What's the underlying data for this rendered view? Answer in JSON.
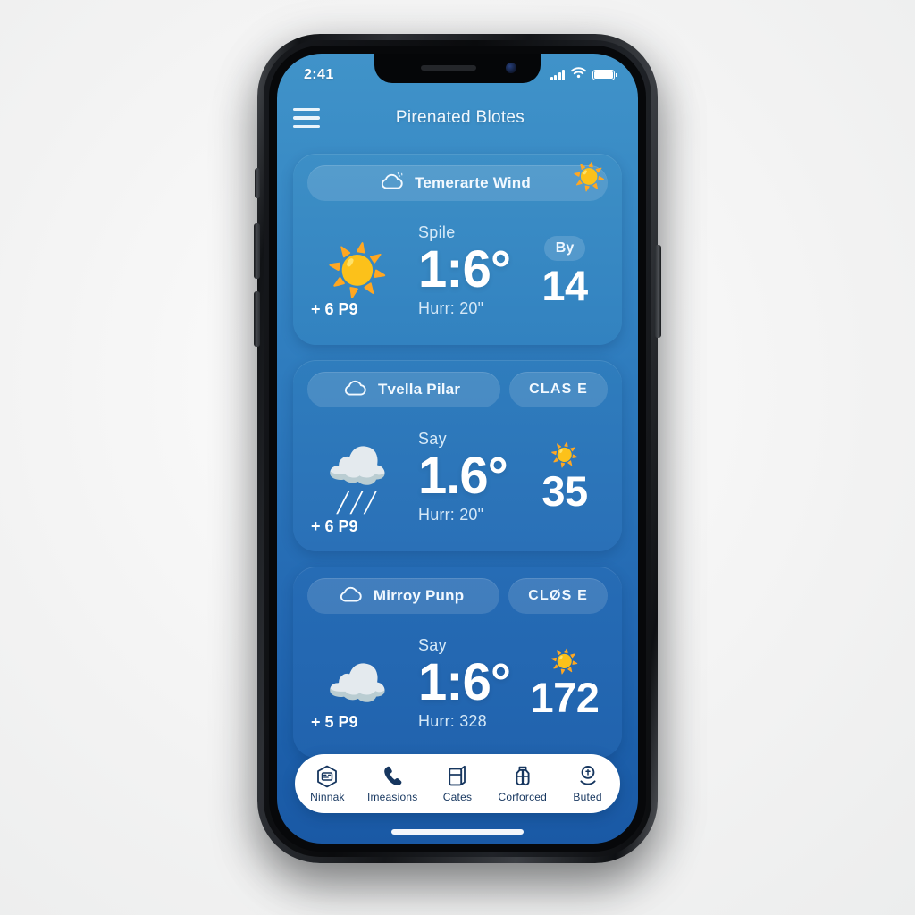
{
  "status_bar": {
    "time": "2:41",
    "signal_icon": "cellular-signal-icon",
    "wifi_icon": "wifi-icon",
    "battery_icon": "battery-full-icon"
  },
  "app_bar": {
    "menu_icon": "hamburger-menu-icon",
    "title": "Pirenated Blotes"
  },
  "cards": [
    {
      "head_icon": "cloud-outline-icon",
      "head_label": "Temerarte Wind",
      "tag": null,
      "corner_icon": "sun-icon",
      "glyph": "☀️",
      "glyph_name": "sun-icon",
      "drops": null,
      "plus_line": "+ 6 P9",
      "temp_label": "Spile",
      "temp_value": "1:6°",
      "temp_sub": "Hurr: 20\"",
      "badge": "By",
      "right_icon": null,
      "right_number": "14"
    },
    {
      "head_icon": "cloud-outline-icon",
      "head_label": "Tvella Pilar",
      "tag": "CLAS E",
      "corner_icon": null,
      "glyph": "☁️",
      "glyph_name": "rain-cloud-icon",
      "drops": "╱╱╱",
      "plus_line": "+ 6 P9",
      "temp_label": "Say",
      "temp_value": "1.6°",
      "temp_sub": "Hurr: 20\"",
      "badge": null,
      "right_icon": "☀️",
      "right_number": "35"
    },
    {
      "head_icon": "cloud-outline-icon",
      "head_label": "Mirroy Punp",
      "tag": "CLØS E",
      "corner_icon": null,
      "glyph": "☁️",
      "glyph_name": "cloud-icon",
      "drops": null,
      "plus_line": "+ 5 P9",
      "temp_label": "Say",
      "temp_value": "1:6°",
      "temp_sub": "Hurr: 328",
      "badge": null,
      "right_icon": "☀️",
      "right_number": "172"
    }
  ],
  "bottom_nav": [
    {
      "icon": "hexagon-badge-icon",
      "label": "Ninnak"
    },
    {
      "icon": "phone-handset-icon",
      "label": "Imeasions"
    },
    {
      "icon": "card-stack-icon",
      "label": "Cates"
    },
    {
      "icon": "binoculars-icon",
      "label": "Corforced"
    },
    {
      "icon": "location-pin-icon",
      "label": "Buted"
    }
  ],
  "colors": {
    "screen_top": "#4093c9",
    "screen_bottom": "#1a59a5",
    "card_1": "#3d8fc6",
    "card_2": "#2f7dbd",
    "card_3": "#266cb5",
    "nav_background": "#ffffff",
    "nav_text": "#16365f",
    "accent_text": "#ffffff"
  }
}
